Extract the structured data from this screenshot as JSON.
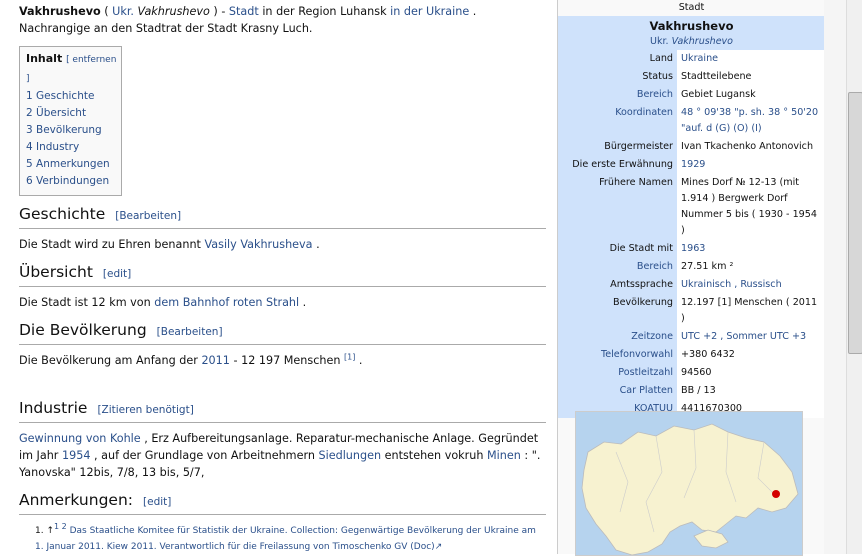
{
  "article": {
    "intro": {
      "name": "Vakhrushevo",
      "paren_open": " ( ",
      "ukr_link": "Ukr.",
      "ukr_name": "Vakhrushevo",
      "paren_close": " ) - ",
      "stadt_link": "Stadt",
      "in_der_region": " in der Region Luhansk ",
      "ukraine_link": "in der Ukraine",
      "rest": " . Nachrangige an den Stadtrat der Stadt Krasny Luch."
    },
    "toc": {
      "title": "Inhalt",
      "remove": "[ entfernen ]",
      "items": [
        "1 Geschichte",
        "2 Übersicht",
        "3 Bevölkerung",
        "4 Industry",
        "5 Anmerkungen",
        "6 Verbindungen"
      ]
    },
    "sections": {
      "geschichte": {
        "title": "Geschichte",
        "edit": "[Bearbeiten]",
        "text_pre": "Die Stadt wird zu Ehren benannt ",
        "link": "Vasily Vakhrusheva",
        "text_post": " ."
      },
      "uebersicht": {
        "title": "Übersicht",
        "edit": "[edit]",
        "text_pre": "Die Stadt ist 12 km von ",
        "link": "dem Bahnhof roten Strahl",
        "text_post": " ."
      },
      "bevoelkerung": {
        "title": "Die Bevölkerung",
        "edit": "[Bearbeiten]",
        "text_pre": "Die Bevölkerung am Anfang der ",
        "link": "2011",
        "text_mid": " - 12 197 Menschen ",
        "sup": "[1]",
        "text_post": " ."
      },
      "industrie": {
        "title": "Industrie",
        "edit": "[Zitieren benötigt]",
        "link1": "Gewinnung von Kohle",
        "text1": " , Erz Aufbereitungsanlage. Reparatur-mechanische Anlage. Gegründet im Jahr ",
        "link2": "1954",
        "text2": " , auf der Grundlage von Arbeitnehmern ",
        "link3": "Siedlungen",
        "text3": " entstehen vokruh ",
        "link4": "Minen",
        "text4": " : \". Yanovska\" 12bis, 7/8, 13 bis, 5/7,"
      },
      "anmerkungen": {
        "title": "Anmerkungen:",
        "edit": "[edit]",
        "ref_marker": "1. ↑",
        "ref_sup": "1 2",
        "ref_text": " Das Staatliche Komitee für Statistik der Ukraine. Collection: Gegenwärtige Bevölkerung der Ukraine am 1. Januar 2011. Kiew 2011. Verantwortlich für die Freilassung von Timoschenko GV (Doc)"
      }
    }
  },
  "infobox": {
    "header": "Stadt",
    "name": "Vakhrushevo",
    "sub_prefix": "Ukr.",
    "sub_name": "Vakhrushevo",
    "rows": [
      {
        "label": "Land",
        "value": "Ukraine",
        "label_link": false,
        "value_link": true
      },
      {
        "label": "Status",
        "value": "Stadtteilebene",
        "label_link": false,
        "value_link": false
      },
      {
        "label": "Bereich",
        "value": "Gebiet Lugansk",
        "label_link": true,
        "value_link": false
      },
      {
        "label": "Koordinaten",
        "value": "48 ° 09'38 \"p. sh. 38 ° 50'20 \"auf. d (G) (O) (I)",
        "label_link": true,
        "value_link": true
      },
      {
        "label": "Bürgermeister",
        "value": "Ivan Tkachenko Antonovich",
        "label_link": false,
        "value_link": false
      },
      {
        "label": "Die erste Erwähnung",
        "value": "1929",
        "label_link": false,
        "value_link": true
      },
      {
        "label": "Frühere Namen",
        "value": "Mines Dorf № 12-13 (mit 1.914 ) Bergwerk Dorf Nummer 5 bis ( 1930 - 1954 )",
        "label_link": false,
        "value_link": false
      },
      {
        "label": "Die Stadt mit",
        "value": "1963",
        "label_link": false,
        "value_link": true
      },
      {
        "label": "Bereich",
        "value": "27.51 km ²",
        "label_link": true,
        "value_link": false
      },
      {
        "label": "Amtssprache",
        "value": "Ukrainisch , Russisch",
        "label_link": false,
        "value_link": true
      },
      {
        "label": "Bevölkerung",
        "value": "12.197 [1] Menschen ( 2011 )",
        "label_link": false,
        "value_link": false
      },
      {
        "label": "Zeitzone",
        "value": "UTC +2 , Sommer UTC +3",
        "label_link": true,
        "value_link": true
      },
      {
        "label": "Telefonvorwahl",
        "value": "+380 6432",
        "label_link": true,
        "value_link": false
      },
      {
        "label": "Postleitzahl",
        "value": "94560",
        "label_link": true,
        "value_link": false
      },
      {
        "label": "Car Platten",
        "value": "BB / 13",
        "label_link": true,
        "value_link": false
      },
      {
        "label": "KOATUU",
        "value": "4411670300",
        "label_link": true,
        "value_link": false
      }
    ]
  },
  "colors": {
    "link": "#2a4f8a",
    "infobox_header": "#cfe2fb",
    "map_land": "#f7f2d0",
    "map_sea": "#b6d3ee",
    "marker": "#d40000"
  }
}
